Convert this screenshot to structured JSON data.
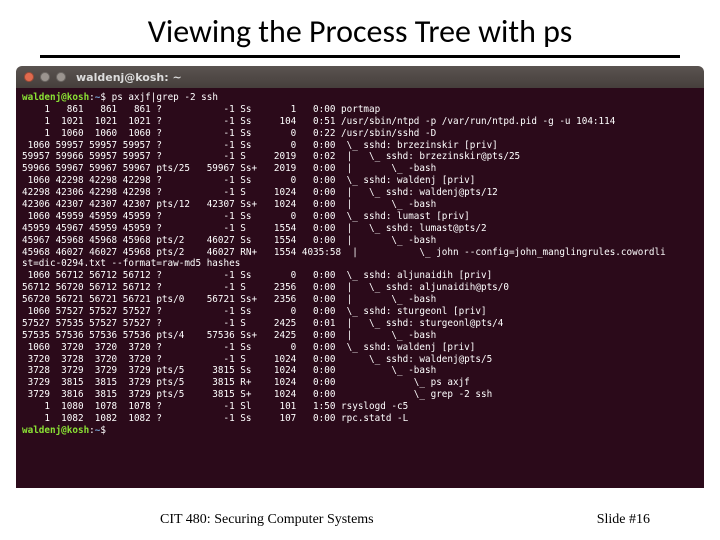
{
  "title": "Viewing the Process Tree with ps",
  "termTitle": "waldenj@kosh: ~",
  "promptUser": "waldenj@kosh",
  "promptPath": "~",
  "promptSymbol": "$",
  "command": "ps axjf|grep -2 ssh",
  "lines": [
    "    1   861   861   861 ?           -1 Ss       1   0:00 portmap",
    "    1  1021  1021  1021 ?           -1 Ss     104   0:51 /usr/sbin/ntpd -p /var/run/ntpd.pid -g -u 104:114",
    "    1  1060  1060  1060 ?           -1 Ss       0   0:22 /usr/sbin/sshd -D",
    " 1060 59957 59957 59957 ?           -1 Ss       0   0:00  \\_ sshd: brzezinskir [priv]",
    "59957 59966 59957 59957 ?           -1 S     2019   0:02  |   \\_ sshd: brzezinskir@pts/25",
    "59966 59967 59967 59967 pts/25   59967 Ss+   2019   0:00  |       \\_ -bash",
    " 1060 42298 42298 42298 ?           -1 Ss       0   0:00  \\_ sshd: waldenj [priv]",
    "42298 42306 42298 42298 ?           -1 S     1024   0:00  |   \\_ sshd: waldenj@pts/12",
    "42306 42307 42307 42307 pts/12   42307 Ss+   1024   0:00  |       \\_ -bash",
    " 1060 45959 45959 45959 ?           -1 Ss       0   0:00  \\_ sshd: lumast [priv]",
    "45959 45967 45959 45959 ?           -1 S     1554   0:00  |   \\_ sshd: lumast@pts/2",
    "45967 45968 45968 45968 pts/2    46027 Ss    1554   0:00  |       \\_ -bash",
    "45968 46027 46027 45968 pts/2    46027 RN+   1554 4035:58  |           \\_ john --config=john_manglingrules.cowordli",
    "st=dic-0294.txt --format=raw-md5 hashes",
    " 1060 56712 56712 56712 ?           -1 Ss       0   0:00  \\_ sshd: aljunaidih [priv]",
    "56712 56720 56712 56712 ?           -1 S     2356   0:00  |   \\_ sshd: aljunaidih@pts/0",
    "56720 56721 56721 56721 pts/0    56721 Ss+   2356   0:00  |       \\_ -bash",
    " 1060 57527 57527 57527 ?           -1 Ss       0   0:00  \\_ sshd: sturgeonl [priv]",
    "57527 57535 57527 57527 ?           -1 S     2425   0:01  |   \\_ sshd: sturgeonl@pts/4",
    "57535 57536 57536 57536 pts/4    57536 Ss+   2425   0:00  |       \\_ -bash",
    " 1060  3720  3720  3720 ?           -1 Ss       0   0:00  \\_ sshd: waldenj [priv]",
    " 3720  3728  3720  3720 ?           -1 S     1024   0:00      \\_ sshd: waldenj@pts/5",
    " 3728  3729  3729  3729 pts/5     3815 Ss    1024   0:00          \\_ -bash",
    " 3729  3815  3815  3729 pts/5     3815 R+    1024   0:00              \\_ ps axjf",
    " 3729  3816  3815  3729 pts/5     3815 S+    1024   0:00              \\_ grep -2 ssh",
    "    1  1080  1078  1078 ?           -1 Sl     101   1:50 rsyslogd -c5",
    "    1  1082  1082  1082 ?           -1 Ss     107   0:00 rpc.statd -L"
  ],
  "footerLeft": "CIT 480: Securing Computer Systems",
  "footerRight": "Slide #16"
}
